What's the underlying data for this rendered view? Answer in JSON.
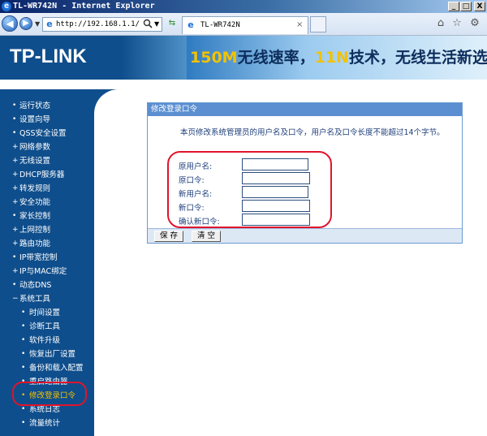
{
  "window": {
    "title": "TL-WR742N - Internet Explorer",
    "min_label": "_",
    "max_label": "□",
    "close_label": "X"
  },
  "browser": {
    "address": "http://192.168.1.1/",
    "tab_label": "TL-WR742N",
    "tab_close": "×"
  },
  "header": {
    "logo": "TP-LINK",
    "slogan_parts": [
      "150M",
      "无线速率，",
      "11N",
      "技术，无线生活新选"
    ]
  },
  "sidebar": {
    "items": [
      {
        "label": "运行状态",
        "sub": false
      },
      {
        "label": "设置向导",
        "sub": false
      },
      {
        "label": "QSS安全设置",
        "sub": false
      },
      {
        "label": "网络参数",
        "sub": false
      },
      {
        "label": "无线设置",
        "sub": false
      },
      {
        "label": "DHCP服务器",
        "sub": false
      },
      {
        "label": "转发规则",
        "sub": false
      },
      {
        "label": "安全功能",
        "sub": false
      },
      {
        "label": "家长控制",
        "sub": false
      },
      {
        "label": "上网控制",
        "sub": false
      },
      {
        "label": "路由功能",
        "sub": false
      },
      {
        "label": "IP带宽控制",
        "sub": false
      },
      {
        "label": "IP与MAC绑定",
        "sub": false
      },
      {
        "label": "动态DNS",
        "sub": false
      },
      {
        "label": "系统工具",
        "sub": false,
        "expanded": true
      },
      {
        "label": "时间设置",
        "sub": true
      },
      {
        "label": "诊断工具",
        "sub": true
      },
      {
        "label": "软件升级",
        "sub": true
      },
      {
        "label": "恢复出厂设置",
        "sub": true
      },
      {
        "label": "备份和载入配置",
        "sub": true
      },
      {
        "label": "重启路由器",
        "sub": true
      },
      {
        "label": "修改登录口令",
        "sub": true,
        "active": true
      },
      {
        "label": "系统日志",
        "sub": true
      },
      {
        "label": "流量统计",
        "sub": true
      }
    ]
  },
  "panel": {
    "title": "修改登录口令",
    "description": "本页修改系统管理员的用户名及口令，用户名及口令长度不能超过14个字节。",
    "fields": [
      {
        "label": "原用户名:",
        "value": ""
      },
      {
        "label": "原口令:",
        "value": ""
      },
      {
        "label": "新用户名:",
        "value": ""
      },
      {
        "label": "新口令:",
        "value": ""
      },
      {
        "label": "确认新口令:",
        "value": ""
      }
    ],
    "save_label": "保 存",
    "clear_label": "清 空"
  },
  "colors": {
    "sidebar_bg": "#0f4e8c",
    "panel_title_bg": "#5b8fd1",
    "highlight": "#e0142b",
    "accent_yellow": "#f2c200"
  }
}
